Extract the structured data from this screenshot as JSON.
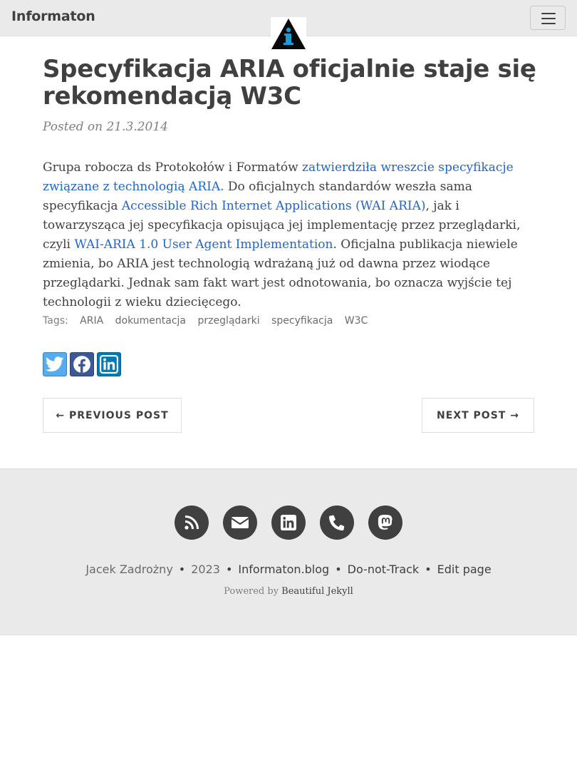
{
  "navbar": {
    "brand": "Informaton",
    "logo_text": "i"
  },
  "post": {
    "title": "Specyfikacja ARIA oficjalnie staje się rekomendacją W3C",
    "meta": "Posted on 21.3.2014",
    "paragraph": {
      "t1": "Grupa robocza ds Protokołów i Formatów ",
      "link1": "zatwierdziła wreszcie specyfikacje związane z technologią ARIA.",
      "t2": " Do oficjalnych standardów weszła sama specyfikacja ",
      "link2": "Accessible Rich Internet Applications (WAI ARIA)",
      "t3": ", jak i towarzysząca jej specyfikacja opisująca jej implementację przez przeglądarki, czyli ",
      "link3": "WAI-ARIA 1.0 User Agent Implementation",
      "t4": ". Oficjalna publikacja niewiele zmienia, bo ARIA jest technologią wdrażaną już od dawna przez wiodące przeglądarki. Jednak sam fakt wart jest odnotowania, bo oznacza wyjście tej technologii z wieku dziecięcego."
    },
    "tags_label": "Tags:",
    "tags": [
      "ARIA",
      "dokumentacja",
      "przeglądarki",
      "specyfikacja",
      "W3C"
    ]
  },
  "share": {
    "icons": [
      "twitter-icon",
      "facebook-icon",
      "linkedin-icon"
    ],
    "colors": {
      "twitter": "#55acee",
      "facebook": "#3b5998",
      "linkedin": "#007bb6"
    }
  },
  "pager": {
    "previous": "← PREVIOUS POST",
    "next": "NEXT POST →"
  },
  "footer": {
    "social_icons": [
      "rss-icon",
      "envelope-icon",
      "linkedin-icon",
      "phone-icon",
      "mastodon-icon"
    ],
    "author": "Jacek Zadrożny",
    "bullet": "•",
    "year": "2023",
    "site": "Informaton.blog",
    "dnt": "Do-not-Track",
    "edit": "Edit page",
    "powered_prefix": "Powered by ",
    "powered_link": "Beautiful Jekyll"
  },
  "colors": {
    "link": "#2266c8",
    "text": "#404040",
    "footer_bg": "#eaeaea",
    "logo_blue": "#1e9bd7"
  }
}
